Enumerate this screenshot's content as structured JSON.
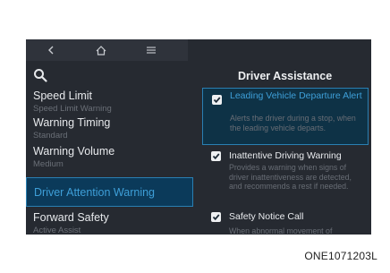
{
  "topbar": {
    "back_icon": "chevron-left-icon",
    "home_icon": "home-icon",
    "menu_icon": "hamburger-menu-icon"
  },
  "search": {
    "icon": "search-icon"
  },
  "left_menu": [
    {
      "label": "Speed Limit",
      "sub": "Speed Limit Warning",
      "selected": false
    },
    {
      "label": "Warning Timing",
      "sub": "Standard",
      "selected": false
    },
    {
      "label": "Warning Volume",
      "sub": "Medium",
      "selected": false
    },
    {
      "label": "Driver Attention Warning",
      "sub": "",
      "selected": true
    },
    {
      "label": "Forward Safety",
      "sub": "Active Assist",
      "selected": false
    }
  ],
  "right_panel": {
    "title": "Driver Assistance",
    "options": [
      {
        "label": "Leading Vehicle Departure Alert",
        "description": "Alerts the driver during a stop, when the leading vehicle departs.",
        "checked": true,
        "highlighted": true
      },
      {
        "label": "Inattentive Driving Warning",
        "description": "Provides a warning when signs of driver inattentiveness are detected, and recommends a rest if needed.",
        "checked": true,
        "highlighted": false
      },
      {
        "label": "Safety Notice Call",
        "description": "When abnormal movement of",
        "checked": true,
        "highlighted": false
      }
    ]
  },
  "caption": "ONE1071203L",
  "colors": {
    "screen_bg": "#262a31",
    "accent_blue": "#3e9fd8",
    "highlight_bg": "#0b3a5a"
  }
}
